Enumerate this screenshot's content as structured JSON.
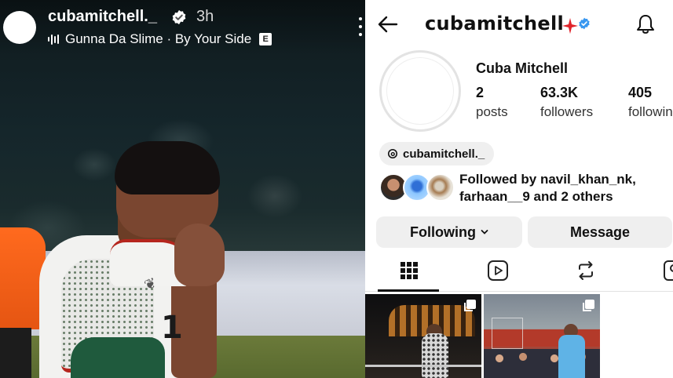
{
  "story": {
    "username": "cubamitchell._",
    "time": "3h",
    "music": "Gunna Da Slime · By Your Side",
    "explicit_badge": "E",
    "jersey_number": "1"
  },
  "profile": {
    "header_handle": "cubamitchell",
    "display_name": "Cuba Mitchell",
    "stats": [
      {
        "value": "2",
        "label": "posts"
      },
      {
        "value": "63.3K",
        "label": "followers"
      },
      {
        "value": "405",
        "label": "following"
      }
    ],
    "threads_handle": "cubamitchell._",
    "followed_by": "Followed by navil_khan_nk, farhaan__9 and 2 others",
    "buttons": {
      "following": "Following",
      "message": "Message"
    },
    "tabs": [
      "grid",
      "reels",
      "reposts",
      "tagged"
    ],
    "active_tab": "grid",
    "colors": {
      "verified": "#3897f0",
      "star": "#e0242b"
    }
  }
}
